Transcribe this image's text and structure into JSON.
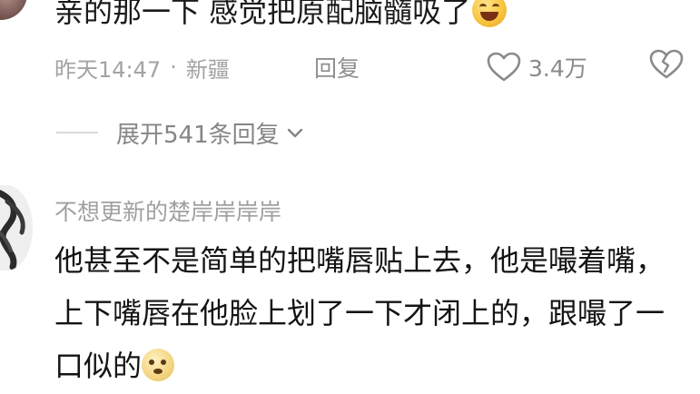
{
  "top_comment": {
    "text": "亲的那一下 感觉把原配脑髓吸了",
    "emoji": "grinning-sweat-emoji",
    "time": "昨天14:47",
    "separator": "·",
    "location": "新疆",
    "reply_label": "回复",
    "like_count": "3.4万",
    "expand_replies_label": "展开541条回复"
  },
  "reply_comment": {
    "username": "不想更新的楚岸岸岸岸",
    "text": "他甚至不是简单的把嘴唇贴上去，他是嘬着嘴，上下嘴唇在他脸上划了一下才闭上的，跟嘬了一口似的",
    "emoji": "shocked-emoji"
  },
  "colors": {
    "text_primary": "#141414",
    "text_secondary": "#a3a3a3",
    "icon": "#8a8a8a"
  },
  "icons": {
    "like": "heart-outline-icon",
    "dislike": "broken-heart-outline-icon",
    "expand": "chevron-down-icon"
  }
}
